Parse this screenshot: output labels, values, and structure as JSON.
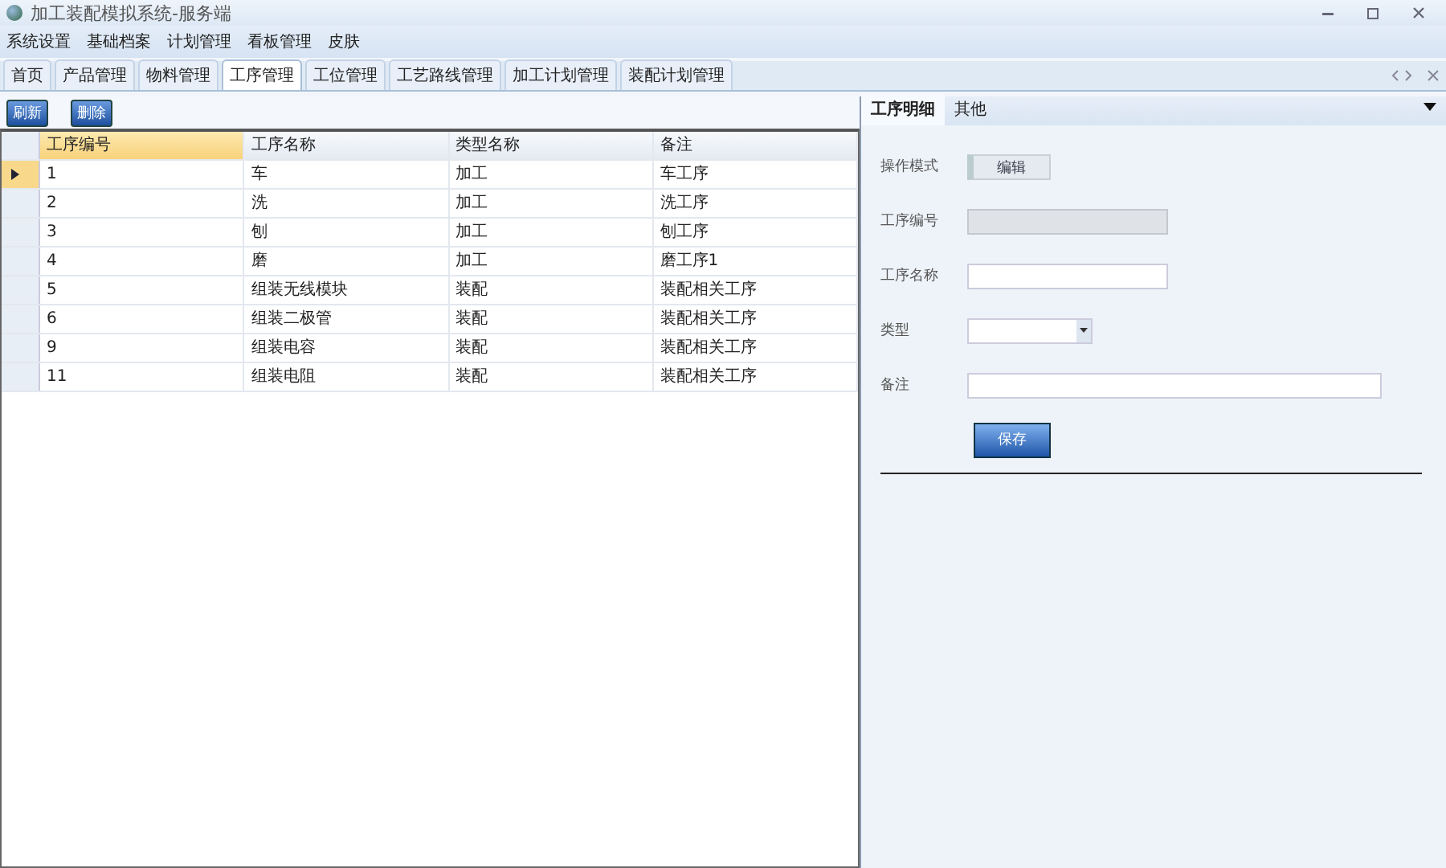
{
  "window": {
    "title": "加工装配模拟系统-服务端"
  },
  "menu": [
    "系统设置",
    "基础档案",
    "计划管理",
    "看板管理",
    "皮肤"
  ],
  "tabs": [
    {
      "label": "首页",
      "selected": false
    },
    {
      "label": "产品管理",
      "selected": false
    },
    {
      "label": "物料管理",
      "selected": false
    },
    {
      "label": "工序管理",
      "selected": true
    },
    {
      "label": "工位管理",
      "selected": false
    },
    {
      "label": "工艺路线管理",
      "selected": false
    },
    {
      "label": "加工计划管理",
      "selected": false
    },
    {
      "label": "装配计划管理",
      "selected": false
    }
  ],
  "toolbar": [
    "刷新",
    "删除"
  ],
  "table": {
    "columns": [
      "工序编号",
      "工序名称",
      "类型名称",
      "备注"
    ],
    "rows": [
      {
        "selected": true,
        "cells": [
          "1",
          "车",
          "加工",
          "车工序"
        ]
      },
      {
        "selected": false,
        "cells": [
          "2",
          "洗",
          "加工",
          "洗工序"
        ]
      },
      {
        "selected": false,
        "cells": [
          "3",
          "刨",
          "加工",
          "刨工序"
        ]
      },
      {
        "selected": false,
        "cells": [
          "4",
          "磨",
          "加工",
          "磨工序1"
        ]
      },
      {
        "selected": false,
        "cells": [
          "5",
          "组装无线模块",
          "装配",
          "装配相关工序"
        ]
      },
      {
        "selected": false,
        "cells": [
          "6",
          "组装二极管",
          "装配",
          "装配相关工序"
        ]
      },
      {
        "selected": false,
        "cells": [
          "9",
          "组装电容",
          "装配",
          "装配相关工序"
        ]
      },
      {
        "selected": false,
        "cells": [
          "11",
          "组装电阻",
          "装配",
          "装配相关工序"
        ]
      }
    ]
  },
  "detail": {
    "tabs": [
      {
        "label": "工序明细",
        "selected": true
      },
      {
        "label": "其他",
        "selected": false
      }
    ],
    "fields": [
      {
        "kind": "toggle",
        "label": "操作模式",
        "value": "编辑"
      },
      {
        "kind": "text",
        "label": "工序编号",
        "disabled": true
      },
      {
        "kind": "text",
        "label": "工序名称",
        "disabled": false
      },
      {
        "kind": "select",
        "label": "类型"
      },
      {
        "kind": "wide",
        "label": "备注"
      }
    ],
    "save": "保存"
  }
}
